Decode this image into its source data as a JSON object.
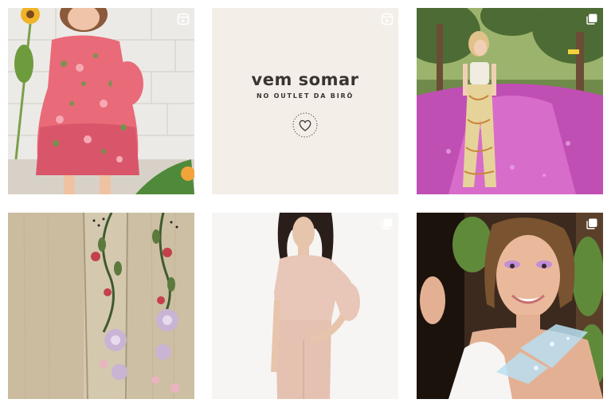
{
  "posts": [
    {
      "kind": "reel",
      "alt_icon": "reel-icon"
    },
    {
      "kind": "reel",
      "alt_icon": "reel-icon",
      "headline": "vem somar",
      "subline": "NO OUTLET DA BIRÔ",
      "background": "#f3efe8",
      "text_color": "#3a3531"
    },
    {
      "kind": "carousel",
      "alt_icon": "carousel-icon"
    },
    {
      "kind": "photo"
    },
    {
      "kind": "carousel",
      "alt_icon": "carousel-icon"
    },
    {
      "kind": "carousel",
      "alt_icon": "carousel-icon"
    }
  ]
}
